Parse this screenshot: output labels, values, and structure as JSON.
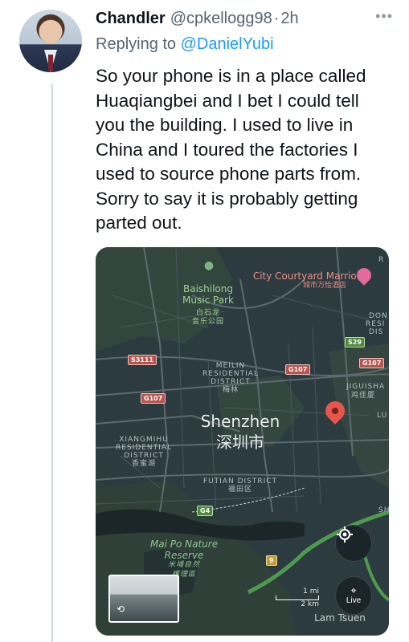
{
  "tweet": {
    "author_name": "Chandler",
    "handle": "@cpkellogg98",
    "separator": "·",
    "time": "2h",
    "more_icon": "ellipsis-icon",
    "reply_prefix": "Replying to",
    "reply_to": "@DanielYubi",
    "text": "So your phone is in a place called\nHuaqiangbei and I bet I could tell\nyou the building. I used to live in\nChina and I toured the factories I\nused to source phone parts from.\nSorry to say it is probably getting\nparted out."
  },
  "map": {
    "city": "Shenzhen",
    "city_cn": "深圳市",
    "places": {
      "baishilong": "Baishilong",
      "music_park": "Music Park",
      "baishilong_cn": "白石龙",
      "music_park_cn": "音乐公园",
      "marriott": "City Courtyard Marriott",
      "marriott_cn": "城市万怡酒店",
      "meilin_1": "MEILIN",
      "meilin_2": "RESIDENTIAL",
      "meilin_3": "DISTRICT",
      "meilin_cn": "梅林",
      "xiangmihu_1": "XIANGMIHU",
      "xiangmihu_2": "RESIDENTIAL",
      "xiangmihu_3": "DISTRICT",
      "xiangmihu_cn": "香蜜湖",
      "futian": "FUTIAN DISTRICT",
      "futian_cn": "福田区",
      "jiguisha": "JIGUISHA",
      "jiguisha_cn": "鸡佳厦",
      "maipo_1": "Mai Po Nature",
      "maipo_2": "Reserve",
      "maipo_cn_1": "米埔自然",
      "maipo_cn_2": "護理區",
      "lam_tsuen": "Lam Tsuen",
      "dong_resi_1": "DON",
      "dong_resi_2": "RESI",
      "dong_resi_3": "DIS",
      "edge_r": "R",
      "edge_lu": "LU",
      "edge_sh": "SH"
    },
    "roads": {
      "s3111": "S3111",
      "g107_a": "G107",
      "g107_b": "G107",
      "g107_c": "G107",
      "s29": "S29",
      "g4": "G4",
      "r9": "9"
    },
    "scale": {
      "top": "1 mi",
      "bottom": "2 km"
    },
    "live_label": "Live",
    "location_icon": "crosshair-icon",
    "pin_icon": "location-pin-icon",
    "live_icon": "street-view-icon",
    "colors": {
      "background": "#2b3b40",
      "pin": "#e5574d",
      "park": "#3a4a3b",
      "water": "#1c2628"
    }
  }
}
